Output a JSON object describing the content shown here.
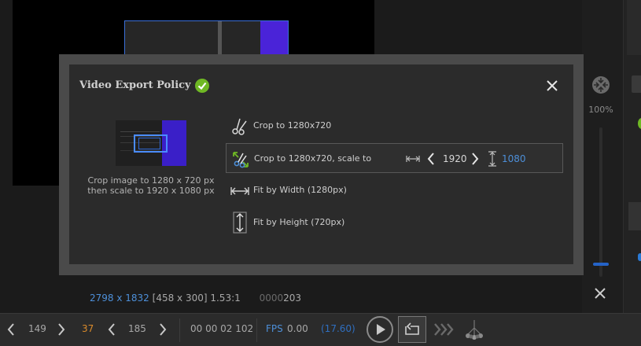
{
  "background": {
    "zoom_label": "100%",
    "status": {
      "dimensions": "2798 x 1832",
      "selection": "[458 x 300] 1.53:1",
      "code_prefix": "0000",
      "code_value": "203"
    },
    "bottom_bar": {
      "value_a": "149",
      "value_b": "37",
      "value_c": "185",
      "timecode": "00 00 02 102",
      "fps_label": "FPS",
      "fps_value": "0.00",
      "fps_target": "(17.60)"
    }
  },
  "dialog": {
    "title": "Video Export Policy",
    "crop_description": "Crop image to 1280 x 720 px\nthen scale to 1920 x 1080 px",
    "options": [
      {
        "label": "Crop to 1280x720",
        "icon": "scissors-icon",
        "selected": false
      },
      {
        "label": "Crop to 1280x720, scale to",
        "icon": "scissors-scale-icon",
        "selected": true
      },
      {
        "label": "Fit by Width (1280px)",
        "icon": "fit-width-icon",
        "selected": false
      },
      {
        "label": "Fit by Height (720px)",
        "icon": "fit-height-icon",
        "selected": false
      }
    ],
    "scale_width": "1920",
    "scale_height": "1080"
  },
  "colors": {
    "accent_blue": "#4d8fd8",
    "success_green": "#6fb824",
    "orange_value": "#d98a2b",
    "crop_frame": "#4a8cff"
  }
}
